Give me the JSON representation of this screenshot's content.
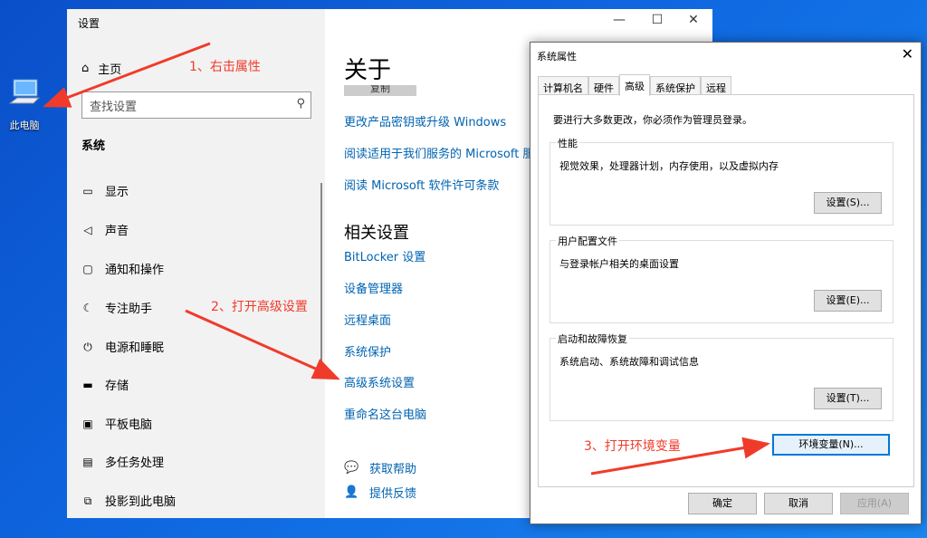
{
  "desktop": {
    "icon_label": "此电脑"
  },
  "settings": {
    "title": "设置",
    "controls": {
      "minimize": "—",
      "maximize": "☐",
      "close": "✕"
    },
    "home_label": "主页",
    "search_placeholder": "查找设置",
    "section": "系统",
    "nav": [
      "显示",
      "声音",
      "通知和操作",
      "专注助手",
      "电源和睡眠",
      "存储",
      "平板电脑",
      "多任务处理",
      "投影到此电脑"
    ],
    "main": {
      "heading": "关于",
      "copy_button": "复制",
      "links": [
        "更改产品密钥或升级 Windows",
        "阅读适用于我们服务的 Microsoft 服务",
        "阅读 Microsoft 软件许可条款"
      ],
      "related_heading": "相关设置",
      "related_links": [
        "BitLocker 设置",
        "设备管理器",
        "远程桌面",
        "系统保护",
        "高级系统设置",
        "重命名这台电脑"
      ],
      "help": [
        "获取帮助",
        "提供反馈"
      ]
    }
  },
  "dialog": {
    "title": "系统属性",
    "close": "✕",
    "tabs": [
      "计算机名",
      "硬件",
      "高级",
      "系统保护",
      "远程"
    ],
    "active_tab": "高级",
    "admin_note": "要进行大多数更改，你必须作为管理员登录。",
    "groups": [
      {
        "legend": "性能",
        "desc": "视觉效果，处理器计划，内存使用，以及虚拟内存",
        "button": "设置(S)..."
      },
      {
        "legend": "用户配置文件",
        "desc": "与登录帐户相关的桌面设置",
        "button": "设置(E)..."
      },
      {
        "legend": "启动和故障恢复",
        "desc": "系统启动、系统故障和调试信息",
        "button": "设置(T)..."
      }
    ],
    "env_button": "环境变量(N)...",
    "ok": "确定",
    "cancel": "取消",
    "apply": "应用(A)"
  },
  "annotations": [
    "1、右击属性",
    "2、打开高级设置",
    "3、打开环境变量"
  ],
  "colors": {
    "annotation": "#f03b2b",
    "link": "#0063b1",
    "desktop": "#0f67e0"
  }
}
